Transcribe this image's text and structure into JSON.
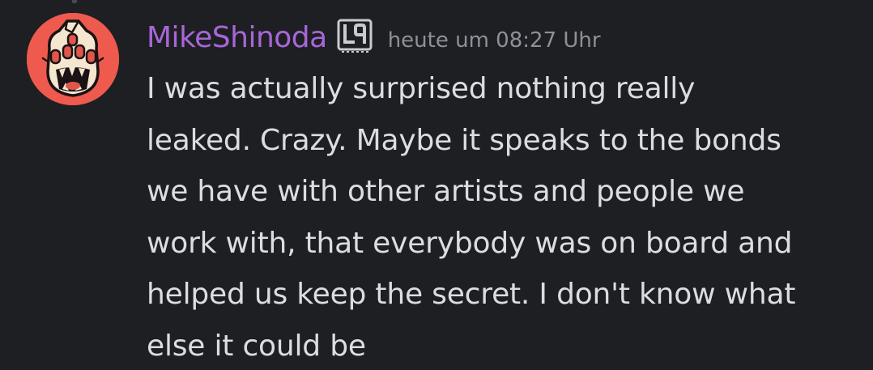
{
  "message": {
    "author": "MikeShinoda",
    "author_color": "#a866d8",
    "timestamp": "heute um 08:27 Uhr",
    "badge_icon": "server-tag-badge-icon",
    "text_lines": [
      "I was actually surprised nothing really",
      "leaked. Crazy. Maybe it speaks to the bonds",
      "we have with other artists and people we",
      "work with, that everybody was on board and",
      "helped us keep the secret. I don't know what",
      "else it could be"
    ]
  },
  "colors": {
    "background": "#1e1f23",
    "message_text": "#dbdde1",
    "timestamp_text": "#8e9099",
    "avatar_background": "#ee5a4d"
  }
}
